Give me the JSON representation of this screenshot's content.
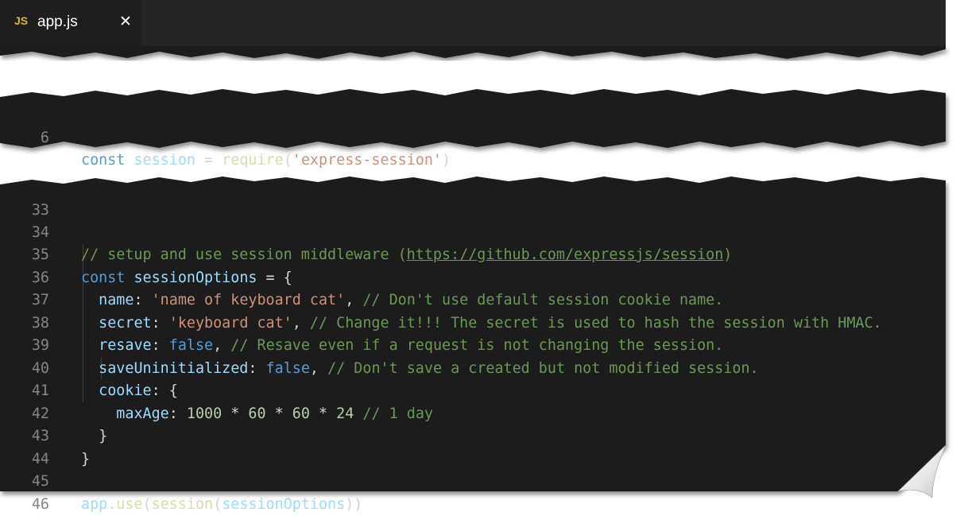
{
  "tab": {
    "lang_badge": "JS",
    "file_name": "app.js",
    "close_glyph": "✕"
  },
  "top_fragment": {
    "ln": "6",
    "kw": "const",
    "var": "session",
    "op": " = ",
    "fn": "require",
    "str": "'express-session'"
  },
  "lines": {
    "l33": {
      "ln": "33"
    },
    "l34": {
      "ln": "34",
      "comment_pre": "// setup and use session middleware (",
      "link": "https://github.com/expressjs/session",
      "comment_post": ")"
    },
    "l35": {
      "ln": "35",
      "kw": "const",
      "var": "sessionOptions",
      "op": " = {"
    },
    "l36": {
      "ln": "36",
      "key": "name",
      "str": "'name of keyboard cat'",
      "comment": "// Don't use default session cookie name."
    },
    "l37": {
      "ln": "37",
      "key": "secret",
      "str": "'keyboard cat'",
      "comment": "// Change it!!! The secret is used to hash the session with HMAC."
    },
    "l38": {
      "ln": "38",
      "key": "resave",
      "val": "false",
      "comment": "// Resave even if a request is not changing the session."
    },
    "l39": {
      "ln": "39",
      "key": "saveUninitialized",
      "val": "false",
      "comment": "// Don't save a created but not modified session."
    },
    "l40": {
      "ln": "40",
      "key": "cookie",
      "op": ": {"
    },
    "l41": {
      "ln": "41",
      "key": "maxAge",
      "expr_n1": "1000",
      "expr_n2": "60",
      "expr_n3": "60",
      "expr_n4": "24",
      "comment": "// 1 day"
    },
    "l42": {
      "ln": "42",
      "op": "}"
    },
    "l43": {
      "ln": "43",
      "op": "}"
    },
    "l44": {
      "ln": "44"
    },
    "l45": {
      "ln": "45",
      "obj": "app",
      "method": "use",
      "fn": "session",
      "arg": "sessionOptions"
    },
    "l46": {
      "ln": "46"
    }
  },
  "colors": {
    "editor_bg": "#1e1e1e",
    "keyword": "#569cd6",
    "variable": "#9cdcfe",
    "function": "#dcdcaa",
    "string": "#ce9178",
    "comment": "#6a9955",
    "number": "#b5cea8"
  }
}
